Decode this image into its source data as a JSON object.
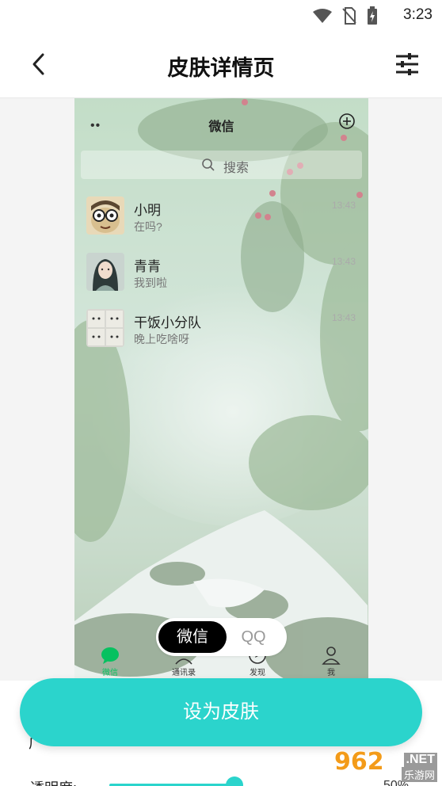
{
  "status_bar": {
    "time": "3:23",
    "icons": [
      "wifi-icon",
      "no-sim-icon",
      "battery-charging-icon"
    ]
  },
  "app_bar": {
    "title": "皮肤详情页",
    "back_icon": "chevron-left-icon",
    "settings_icon": "sliders-icon"
  },
  "preview": {
    "wechat_title": "微信",
    "menu_icon": "more-dots-icon",
    "add_icon": "plus-circle-icon",
    "search_placeholder": "搜索",
    "chats": [
      {
        "name": "小明",
        "message": "在吗?",
        "time": "13:43",
        "avatar": "glasses-face-avatar"
      },
      {
        "name": "青青",
        "message": "我到啦",
        "time": "13:43",
        "avatar": "girl-avatar"
      },
      {
        "name": "干饭小分队",
        "message": "晚上吃啥呀",
        "time": "13:43",
        "avatar": "group-avatar"
      }
    ],
    "tabs": [
      {
        "label": "微信",
        "icon": "chat-bubble-icon",
        "active": true
      },
      {
        "label": "通讯录",
        "icon": "contacts-icon",
        "active": false
      },
      {
        "label": "发现",
        "icon": "compass-icon",
        "active": false
      },
      {
        "label": "我",
        "icon": "person-icon",
        "active": false
      }
    ]
  },
  "segment": {
    "option_wechat": "微信",
    "option_qq": "QQ",
    "selected": "微信"
  },
  "cta": {
    "label": "设为皮肤"
  },
  "settings": {
    "opacity_label": "透明度:",
    "opacity_value": "50%",
    "opacity_fraction": 0.5
  },
  "watermark": {
    "brand": "962",
    "domain": ".NET",
    "site": "乐游网"
  },
  "colors": {
    "accent": "#2bd4cc",
    "wechat_green": "#07c160",
    "segment_active": "#000000"
  }
}
